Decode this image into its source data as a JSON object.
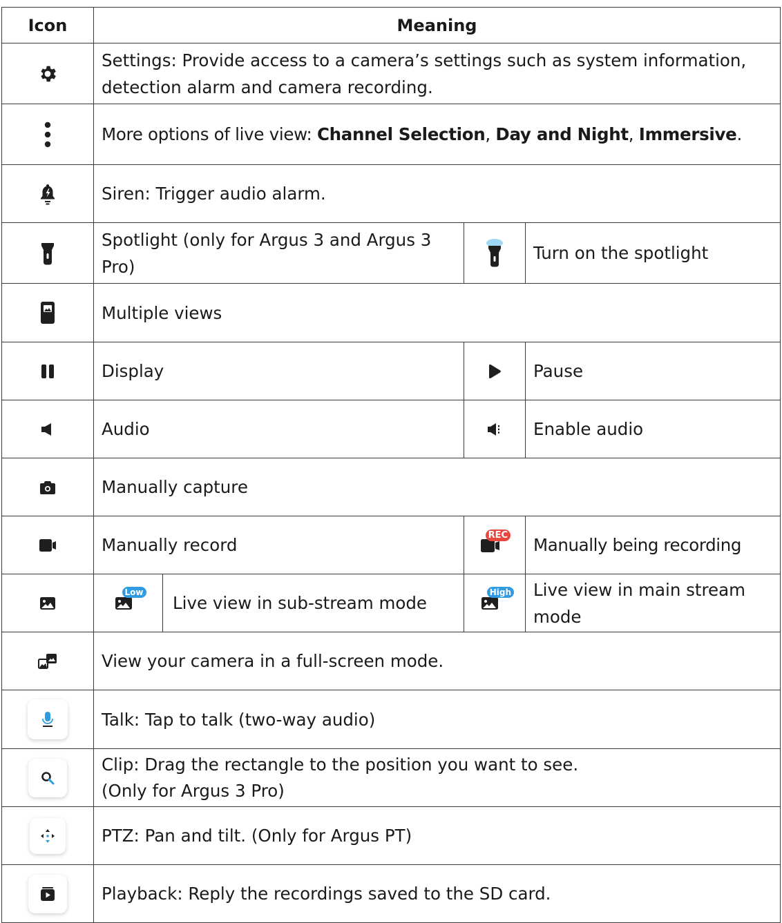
{
  "header": {
    "icon": "Icon",
    "meaning": "Meaning"
  },
  "rows": {
    "settings": {
      "icon": "gear-icon",
      "text": "Settings: Provide access to a camera’s settings such as system information, detection alarm and camera recording."
    },
    "more": {
      "icon": "more-vertical-icon",
      "prefix": "More options of live view: ",
      "b1": "Channel Selection",
      "sep1": ", ",
      "b2": "Day and Night",
      "sep2": ", ",
      "b3": "Immersive",
      "suffix": "."
    },
    "siren": {
      "icon": "siren-bell-icon",
      "text": "Siren: Trigger audio alarm."
    },
    "spotlight": {
      "icon": "spotlight-icon",
      "text": "Spotlight (only for Argus 3 and Argus 3 Pro)",
      "icon2": "spotlight-on-icon",
      "text2": "Turn on the spotlight"
    },
    "multiple": {
      "icon": "multiple-views-icon",
      "text": "Multiple views"
    },
    "display": {
      "icon": "pause-icon",
      "text": "Display",
      "icon2": "play-icon",
      "text2": "Pause"
    },
    "audio": {
      "icon": "speaker-muted-icon",
      "text": "Audio",
      "icon2": "speaker-on-icon",
      "text2": "Enable audio"
    },
    "capture": {
      "icon": "camera-icon",
      "text": "Manually capture"
    },
    "record": {
      "icon": "video-camera-icon",
      "text": "Manually record",
      "icon2": "recording-icon",
      "badge2": "REC",
      "text2": "Manually being recording"
    },
    "stream": {
      "icon": "image-icon",
      "icon_low": "image-low-icon",
      "badge_low": "Low",
      "text": "Live view in sub-stream mode",
      "icon2": "image-high-icon",
      "badge2": "High",
      "text2": "Live view in main stream mode"
    },
    "fullscreen": {
      "icon": "fullscreen-icon",
      "text": "View your camera in a full-screen mode."
    },
    "talk": {
      "icon": "microphone-icon",
      "text": "Talk: Tap to talk (two-way audio)"
    },
    "clip": {
      "icon": "magnifier-icon",
      "line1": "Clip: Drag the rectangle to the position you want to see.",
      "line2": "(Only for Argus 3 Pro)"
    },
    "ptz": {
      "icon": "pan-tilt-icon",
      "text": "PTZ: Pan and tilt. (Only for Argus PT)"
    },
    "playback": {
      "icon": "playback-icon",
      "text": "Playback: Reply the recordings saved to the SD card."
    }
  },
  "colors": {
    "icon": "#1f1f1f",
    "accent_blue": "#2f9be0",
    "rec_red": "#e8473f",
    "border": "#3a3a3a"
  }
}
